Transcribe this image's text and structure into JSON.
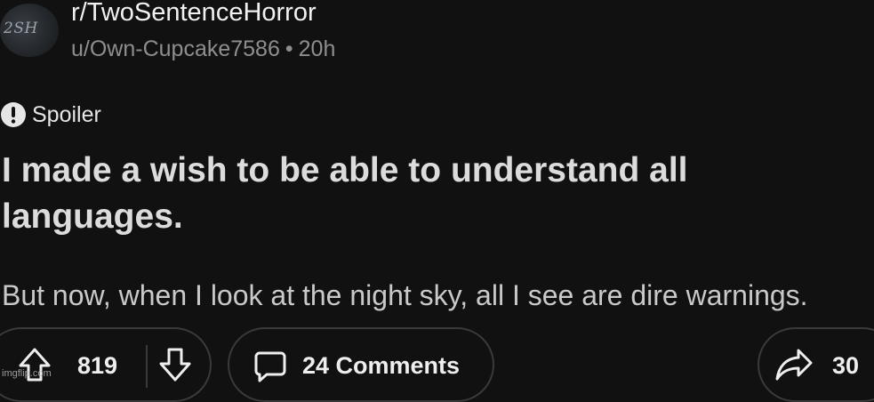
{
  "post": {
    "subreddit": "r/TwoSentenceHorror",
    "avatar_text": "2SH",
    "author": "u/Own-Cupcake7586",
    "separator": "•",
    "age": "20h",
    "flair": "Spoiler",
    "flair_icon": "exclamation-circle-icon",
    "title": "I made a wish to be able to understand all languages.",
    "body": "But now, when I look at the night sky, all I see are dire warnings."
  },
  "actions": {
    "upvote_icon": "arrow-up-icon",
    "score": "819",
    "downvote_icon": "arrow-down-icon",
    "comments_icon": "comment-bubble-icon",
    "comments_label": "24 Comments",
    "share_icon": "share-arrow-icon",
    "shares": "30"
  },
  "watermark": "imgflip.com",
  "colors": {
    "background": "#111111",
    "text_primary": "#e6e6e6",
    "text_secondary": "#8e8e8e",
    "pill_border": "#3a3a3a"
  }
}
